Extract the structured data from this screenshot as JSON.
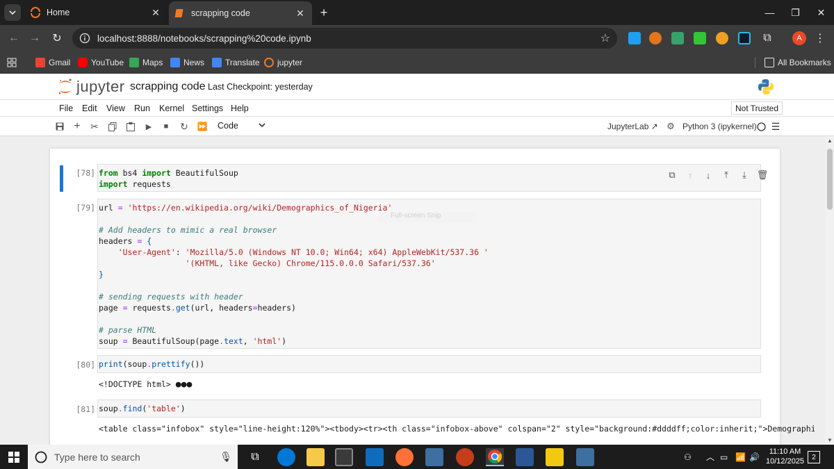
{
  "browser": {
    "tabs": [
      {
        "title": "Home",
        "active": false
      },
      {
        "title": "scrapping code",
        "active": true
      }
    ],
    "url": "localhost:8888/notebooks/scrapping%20code.ipynb",
    "profile_initial": "A",
    "bookmarks": [
      "Gmail",
      "YouTube",
      "Maps",
      "News",
      "Translate",
      "jupyter"
    ],
    "all_bookmarks": "All Bookmarks"
  },
  "jupyter": {
    "logo_text": "jupyter",
    "notebook_title": "scrapping code",
    "checkpoint": "Last Checkpoint: yesterday",
    "menu": [
      "File",
      "Edit",
      "View",
      "Run",
      "Kernel",
      "Settings",
      "Help"
    ],
    "trust_status": "Not Trusted",
    "cell_type": "Code",
    "jupyterlab_link": "JupyterLab",
    "kernel": "Python 3 (ipykernel)"
  },
  "cells": [
    {
      "prompt": "[78]:"
    },
    {
      "prompt": "[79]:",
      "ghost_text": "Full-screen Snip"
    },
    {
      "prompt": "[80]:",
      "output": "<!DOCTYPE html>"
    },
    {
      "prompt": "[81]:",
      "output": "<table class=\"infobox\" style=\"line-height:120%\"><tbody><tr><th class=\"infobox-above\" colspan=\"2\" style=\"background:#ddddff;color:inherit;\">Demographics of <a href=\"..."
    }
  ],
  "taskbar": {
    "search_placeholder": "Type here to search",
    "time": "11:10 AM",
    "date": "10/12/2025",
    "notifications": "2"
  },
  "colors": {
    "accent": "#1976d2",
    "jupyter_orange": "#f37726",
    "keyword": "#008000",
    "string": "#ba2121",
    "comment": "#3d7b7b"
  }
}
